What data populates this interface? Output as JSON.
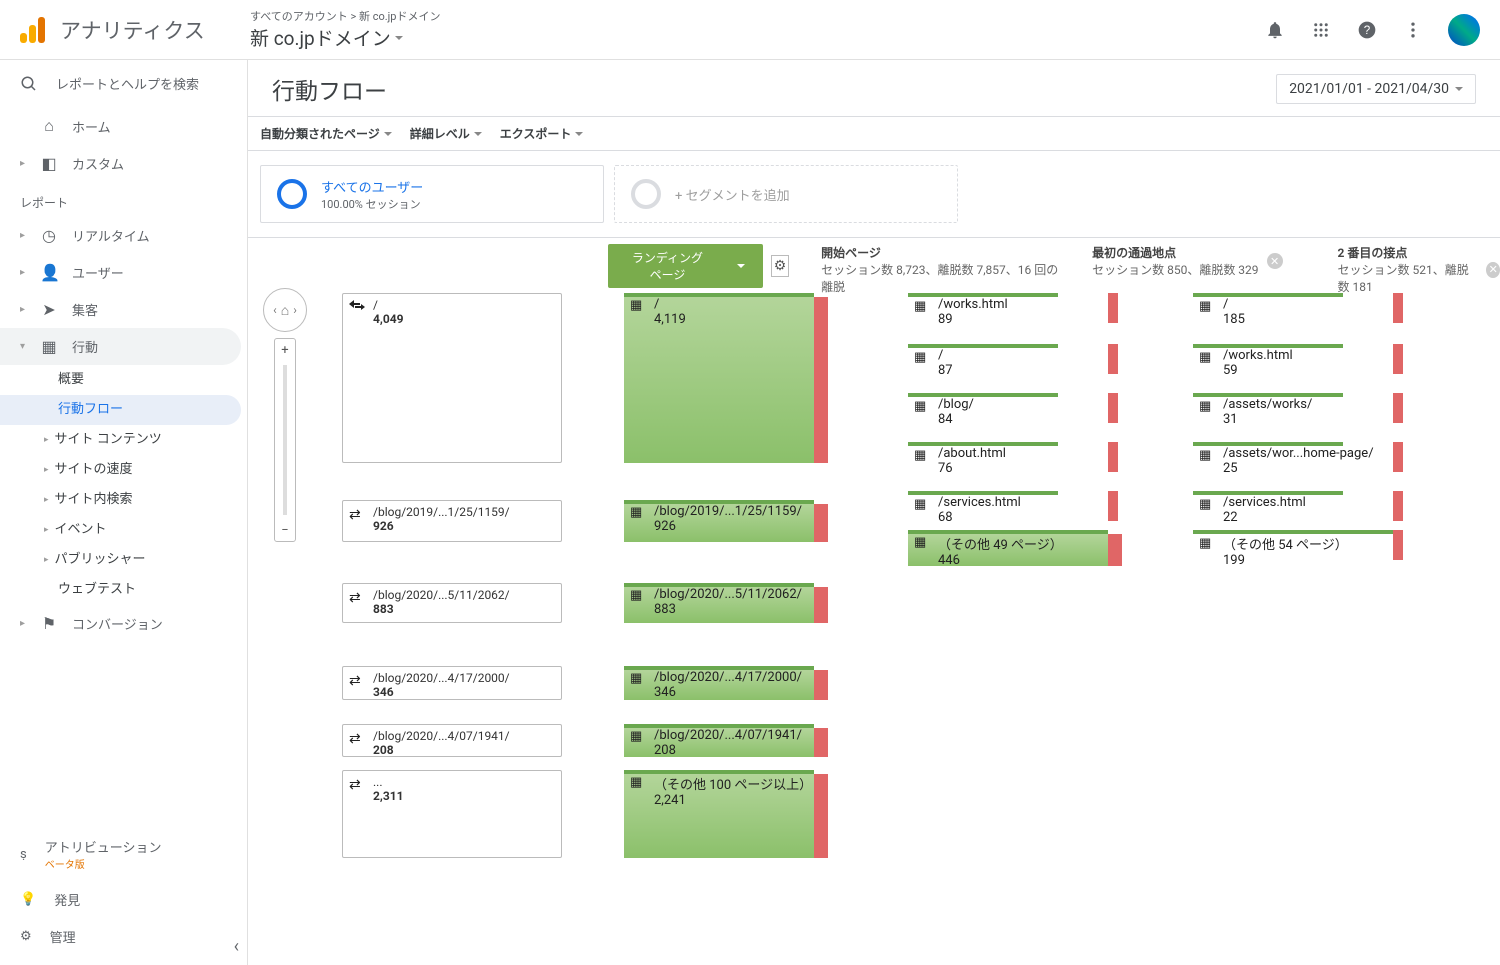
{
  "brand": "アナリティクス",
  "account_path": "すべてのアカウント > 新 co.jpドメイン",
  "account_current": "新 co.jpドメイン",
  "search_placeholder": "レポートとヘルプを検索",
  "nav": {
    "home": "ホーム",
    "custom": "カスタム",
    "reports": "レポート",
    "realtime": "リアルタイム",
    "users": "ユーザー",
    "acquisition": "集客",
    "behavior": "行動",
    "behavior_items": {
      "overview": "概要",
      "flow": "行動フロー",
      "content": "サイト コンテンツ",
      "speed": "サイトの速度",
      "search": "サイト内検索",
      "events": "イベント",
      "publisher": "パブリッシャー",
      "webtest": "ウェブテスト"
    },
    "conversion": "コンバージョン",
    "attribution": "アトリビューション",
    "beta": "ベータ版",
    "discover": "発見",
    "admin": "管理"
  },
  "page_title": "行動フロー",
  "date_range": "2021/01/01 - 2021/04/30",
  "toolbar": {
    "classify": "自動分類されたページ",
    "detail": "詳細レベル",
    "export": "エクスポート"
  },
  "segment": {
    "all_users": "すべてのユーザー",
    "all_users_sub": "100.00% セッション",
    "add": "+ セグメントを追加"
  },
  "flow": {
    "landing_btn": "ランディング ページ",
    "col1": {
      "title": "開始ページ",
      "sub": "セッション数 8,723、離脱数 7,857、16 回の離脱"
    },
    "col2": {
      "title": "最初の通過地点",
      "sub": "セッション数 850、離脱数 329"
    },
    "col3": {
      "title": "2 番目の接点",
      "sub": "セッション数 521、離脱数 181"
    }
  },
  "nodes": {
    "c0": [
      {
        "label": "/",
        "val": "4,049"
      },
      {
        "label": "/blog/2019/...1/25/1159/",
        "val": "926"
      },
      {
        "label": "/blog/2020/...5/11/2062/",
        "val": "883"
      },
      {
        "label": "/blog/2020/...4/17/2000/",
        "val": "346"
      },
      {
        "label": "/blog/2020/...4/07/1941/",
        "val": "208"
      },
      {
        "label": "...",
        "val": "2,311"
      }
    ],
    "c1": [
      {
        "label": "/",
        "val": "4,119"
      },
      {
        "label": "/blog/2019/...1/25/1159/",
        "val": "926"
      },
      {
        "label": "/blog/2020/...5/11/2062/",
        "val": "883"
      },
      {
        "label": "/blog/2020/...4/17/2000/",
        "val": "346"
      },
      {
        "label": "/blog/2020/...4/07/1941/",
        "val": "208"
      },
      {
        "label": "（その他 100 ページ以上）",
        "val": "2,241"
      }
    ],
    "c2": [
      {
        "label": "/works.html",
        "val": "89"
      },
      {
        "label": "/",
        "val": "87"
      },
      {
        "label": "/blog/",
        "val": "84"
      },
      {
        "label": "/about.html",
        "val": "76"
      },
      {
        "label": "/services.html",
        "val": "68"
      },
      {
        "label": "（その他 49 ページ）",
        "val": "446"
      }
    ],
    "c3": [
      {
        "label": "/",
        "val": "185"
      },
      {
        "label": "/works.html",
        "val": "59"
      },
      {
        "label": "/assets/works/",
        "val": "31"
      },
      {
        "label": "/assets/wor...home-page/",
        "val": "25"
      },
      {
        "label": "/services.html",
        "val": "22"
      },
      {
        "label": "（その他 54 ページ）",
        "val": "199"
      }
    ]
  }
}
